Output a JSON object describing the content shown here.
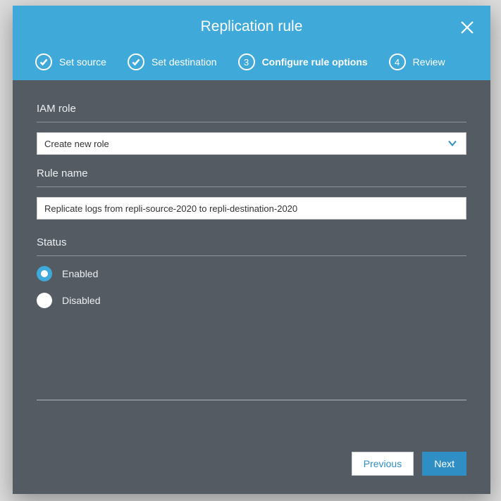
{
  "modal": {
    "title": "Replication rule",
    "steps": [
      {
        "label": "Set source",
        "state": "done"
      },
      {
        "label": "Set destination",
        "state": "done"
      },
      {
        "label": "Configure rule options",
        "state": "active",
        "num": "3"
      },
      {
        "label": "Review",
        "state": "pending",
        "num": "4"
      }
    ],
    "iam": {
      "label": "IAM role",
      "selected": "Create new role"
    },
    "ruleName": {
      "label": "Rule name",
      "value": "Replicate logs from repli-source-2020 to repli-destination-2020"
    },
    "status": {
      "label": "Status",
      "options": [
        {
          "label": "Enabled",
          "selected": true
        },
        {
          "label": "Disabled",
          "selected": false
        }
      ]
    },
    "footer": {
      "previous": "Previous",
      "next": "Next"
    }
  }
}
